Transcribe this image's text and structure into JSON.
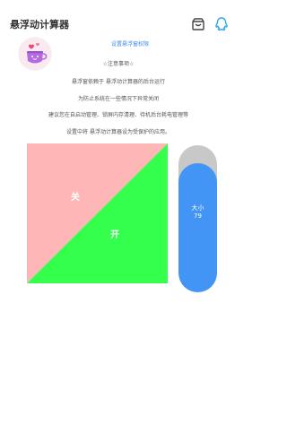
{
  "header": {
    "title": "悬浮动计算器",
    "store_icon": "store-icon",
    "qq_icon": "qq-icon"
  },
  "permission_link": "设置悬浮窗权限",
  "notes": {
    "heading": "☆注意事项☆",
    "lines": [
      "悬浮窗依赖于 悬浮动计算器的后台运行",
      "为防止系统在一些情况下异常关闭",
      "建议您在自启动管理、锁屏内存清理、待机后台耗电管理等",
      "设置中将 悬浮动计算器设为受保护的应用。"
    ]
  },
  "toggle": {
    "off_label": "关",
    "on_label": "开",
    "off_color": "#ffb6b6",
    "on_color": "#33ff4c"
  },
  "size_slider": {
    "label": "大小",
    "value": "79",
    "fill_fraction": 0.88,
    "track_color": "#c8c8c8",
    "fill_color": "#4295f5"
  }
}
